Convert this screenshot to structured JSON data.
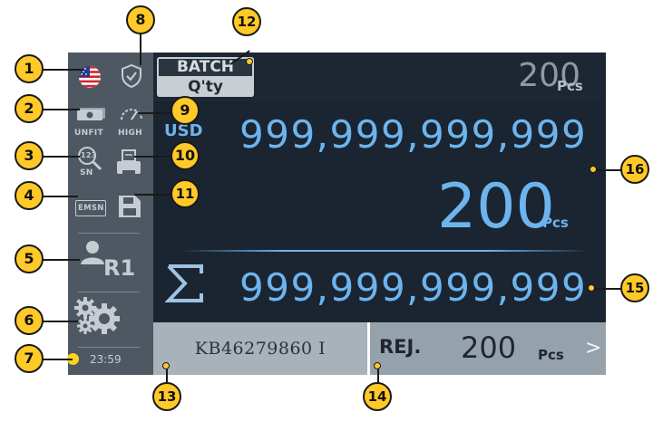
{
  "sidebar": {
    "unfit_label": "UNFIT",
    "speed_label": "HIGH",
    "sn_label": "SN",
    "sn_search_digits": "123",
    "emsn_label": "EMSN",
    "user_label": "R1",
    "time": "23:59"
  },
  "header": {
    "batch_label": "BATCH",
    "qty_label": "Q'ty",
    "batch_count": "200",
    "batch_unit": "Pcs"
  },
  "main": {
    "currency": "USD",
    "amount": "999,999,999,999",
    "count": "200",
    "count_unit": "Pcs",
    "total_amount": "999,999,999,999"
  },
  "footer": {
    "serial_number": "KB46279860 I",
    "reject_label": "REJ.",
    "reject_count": "200",
    "reject_unit": "Pcs",
    "reject_arrow": ">"
  },
  "callouts": [
    "1",
    "2",
    "3",
    "4",
    "5",
    "6",
    "7",
    "8",
    "9",
    "10",
    "11",
    "12",
    "13",
    "14",
    "15",
    "16"
  ],
  "colors": {
    "accent_blue": "#6db4ee",
    "callout_yellow": "#ffc928",
    "sidebar_gray": "#4d5862",
    "screen_dark": "#1a2531"
  },
  "icons": [
    "flag-us-icon",
    "shield-check-icon",
    "banknote-icon",
    "speed-gauge-icon",
    "serial-search-icon",
    "printer-icon",
    "save-icon",
    "user-icon",
    "gears-icon",
    "status-dot-icon",
    "sigma-icon"
  ]
}
